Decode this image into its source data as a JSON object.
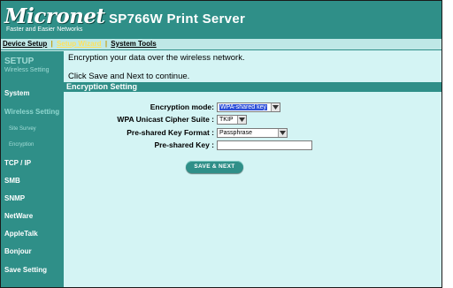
{
  "header": {
    "logo_text": "Micronet",
    "logo_tagline": "Faster and Easier Networks",
    "product_title": "SP766W Print Server"
  },
  "topnav": {
    "items": [
      {
        "label": "Device Setup",
        "active": false
      },
      {
        "label": "Setup Wizard",
        "active": true
      },
      {
        "label": "System Tools",
        "active": false
      }
    ],
    "separator": "|"
  },
  "sidebar": {
    "setup_title": "SETUP",
    "setup_subtitle": "Wireless Setting",
    "items": [
      {
        "label": "System"
      },
      {
        "label": "Wireless Setting"
      },
      {
        "label": "Site Survey"
      },
      {
        "label": "Encryption"
      },
      {
        "label": "TCP / IP"
      },
      {
        "label": "SMB"
      },
      {
        "label": "SNMP"
      },
      {
        "label": "NetWare"
      },
      {
        "label": "AppleTalk"
      },
      {
        "label": "Bonjour"
      },
      {
        "label": "Save Setting"
      }
    ]
  },
  "main": {
    "intro_line1": "Encryption your data over the wireless network.",
    "intro_line2": "Click Save and Next to continue.",
    "section_title": "Encryption Setting",
    "fields": {
      "encryption_mode": {
        "label": "Encryption mode:",
        "value": "WPA-shared key"
      },
      "cipher_suite": {
        "label": "WPA Unicast Cipher Suite :",
        "value": "TKIP"
      },
      "key_format": {
        "label": "Pre-shared Key Format :",
        "value": "Passphrase"
      },
      "preshared_key": {
        "label": "Pre-shared Key :",
        "value": ""
      }
    },
    "save_button": "SAVE & NEXT"
  },
  "colors": {
    "brand_teal": "#2f8f88",
    "content_bg": "#d4f4f4",
    "active_nav": "#ffe25a"
  }
}
